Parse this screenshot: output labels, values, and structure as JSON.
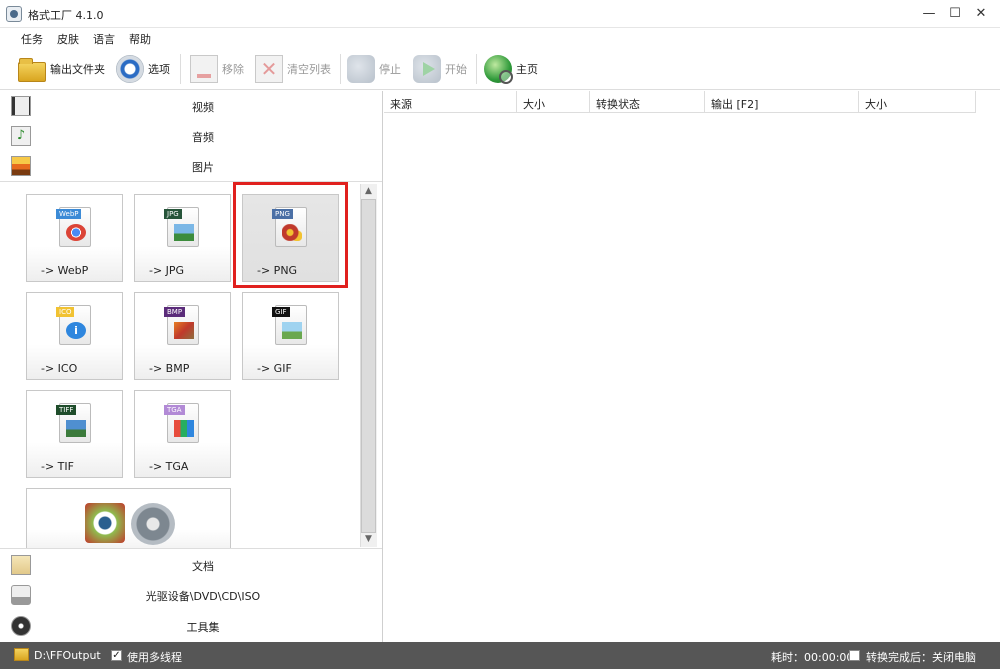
{
  "window": {
    "title": "格式工厂 4.1.0",
    "minimize": "—",
    "maximize": "☐",
    "close": "✕"
  },
  "menu": [
    "任务",
    "皮肤",
    "语言",
    "帮助"
  ],
  "toolbar": {
    "output_folder": "输出文件夹",
    "options": "选项",
    "remove": "移除",
    "clear_list": "清空列表",
    "stop": "停止",
    "start": "开始",
    "home": "主页"
  },
  "categories": {
    "video": "视频",
    "audio": "音频",
    "image": "图片",
    "document": "文档",
    "optical": "光驱设备\\DVD\\CD\\ISO",
    "toolbox": "工具集"
  },
  "tiles": [
    {
      "tag": "WebP",
      "label": "-> WebP",
      "tag_color": "#3b8ad6"
    },
    {
      "tag": "JPG",
      "label": "-> JPG",
      "tag_color": "#27553a"
    },
    {
      "tag": "PNG",
      "label": "-> PNG",
      "tag_color": "#4a6fa5"
    },
    {
      "tag": "ICO",
      "label": "-> ICO",
      "tag_color": "#f1c232"
    },
    {
      "tag": "BMP",
      "label": "-> BMP",
      "tag_color": "#5b2c7a"
    },
    {
      "tag": "GIF",
      "label": "-> GIF",
      "tag_color": "#111111"
    },
    {
      "tag": "TIFF",
      "label": "-> TIF",
      "tag_color": "#1f4d2b"
    },
    {
      "tag": "TGA",
      "label": "-> TGA",
      "tag_color": "#b28ad6"
    }
  ],
  "columns": [
    "来源",
    "大小",
    "转换状态",
    "输出 [F2]",
    "大小"
  ],
  "status": {
    "output_path": "D:\\FFOutput",
    "multithread": "使用多线程",
    "elapsed": "耗时：00:00:00",
    "after_done": "转换完成后：关闭电脑",
    "check": "✓"
  }
}
